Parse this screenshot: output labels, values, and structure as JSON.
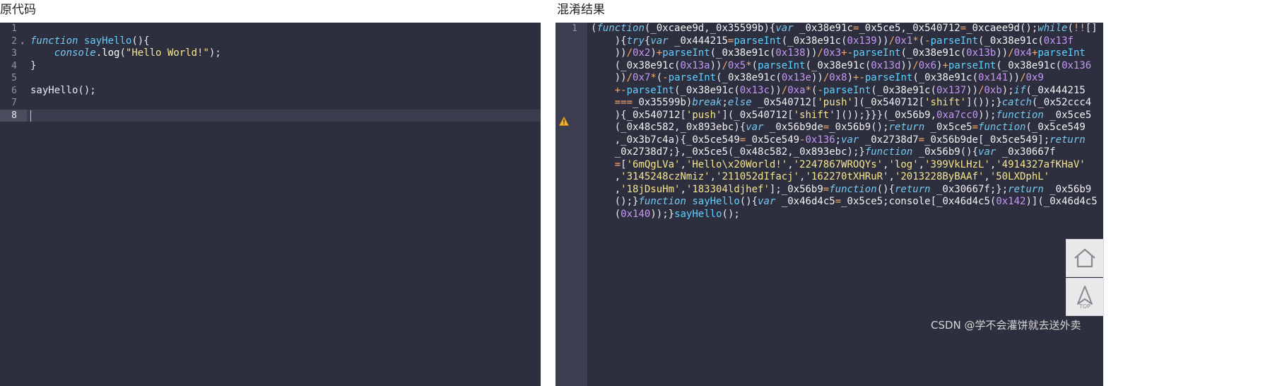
{
  "left_panel": {
    "title": "原代码",
    "line_numbers": [
      "1",
      "2",
      "3",
      "4",
      "5",
      "6",
      "7",
      "8"
    ],
    "code": {
      "l2_kw": "function",
      "l2_fn": "sayHello",
      "l2_rest": "(){",
      "l3_obj": "console",
      "l3_dot": ".",
      "l3_fn": "log",
      "l3_open": "(",
      "l3_str": "\"Hello World!\"",
      "l3_close": ");",
      "l4": "}",
      "l6": "sayHello();"
    }
  },
  "right_panel": {
    "title": "混淆结果",
    "line_number": "1",
    "warning_icon": "warning-triangle-icon",
    "wrapped_lines": [
      "(function(_0xcaee9d,_0x35599b){var _0x38e91c=_0x5ce5,_0x540712=_0xcaee9d();while(!![]",
      "    ){try{var _0x444215=parseInt(_0x38e91c(0x139))/0x1*(-parseInt(_0x38e91c(0x13f",
      "    ))/0x2)+parseInt(_0x38e91c(0x138))/0x3+-parseInt(_0x38e91c(0x13b))/0x4+parseInt",
      "    (_0x38e91c(0x13a))/0x5*(parseInt(_0x38e91c(0x13d))/0x6)+parseInt(_0x38e91c(0x136",
      "    ))/0x7*(-parseInt(_0x38e91c(0x13e))/0x8)+-parseInt(_0x38e91c(0x141))/0x9",
      "    +-parseInt(_0x38e91c(0x13c))/0xa*(-parseInt(_0x38e91c(0x137))/0xb);if(_0x444215",
      "    ===_0x35599b)break;else _0x540712['push'](_0x540712['shift']());}catch(_0x52ccc4",
      "    ){_0x540712['push'](_0x540712['shift']());}}}(_0x56b9,0xa7cc0));function _0x5ce5",
      "    (_0x48c582,_0x893ebc){var _0x56b9de=_0x56b9();return _0x5ce5=function(_0x5ce549",
      "    ,_0x3b7c4a){_0x5ce549=_0x5ce549-0x136;var _0x2738d7=_0x56b9de[_0x5ce549];return",
      "    _0x2738d7;},_0x5ce5(_0x48c582,_0x893ebc);}function _0x56b9(){var _0x30667f",
      "    =['6mQgLVa','Hello\\x20World!','2247867WROQYs','log','399VkLHzL','4914327afKHaV'",
      "    ,'3145248czNmiz','211052dIfacj','162270tXHRuR','2013228ByBAAf','50LXDphL'",
      "    ,'18jDsuHm','183304ldjhef'];_0x56b9=function(){return _0x30667f;};return _0x56b9",
      "    ();}function sayHello(){var _0x46d4c5=_0x5ce5;console[_0x46d4c5(0x142)](_0x46d4c5",
      "    (0x140));}sayHello();"
    ]
  },
  "fabs": {
    "home_icon": "home-icon",
    "top_icon": "back-to-top-icon",
    "top_label": "TOP"
  },
  "watermark": "CSDN @学不会灌饼就去送外卖",
  "colors": {
    "editor_bg": "#2d2f3e",
    "keyword": "#78c8f0",
    "string": "#f6e58f",
    "number": "#c797f5",
    "operator": "#f5a86a"
  }
}
